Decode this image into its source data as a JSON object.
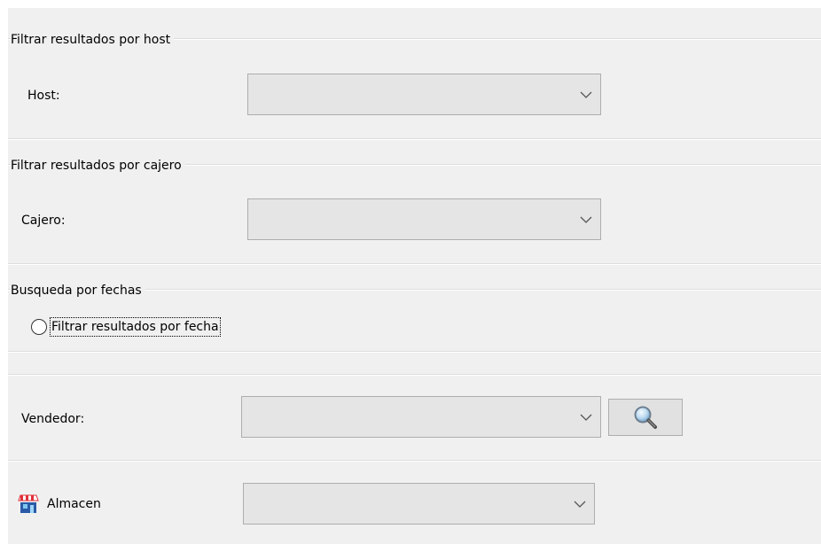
{
  "groups": {
    "host": {
      "title": "Filtrar resultados por host",
      "label": "Host:",
      "value": ""
    },
    "cajero": {
      "title": "Filtrar resultados por cajero",
      "label": "Cajero:",
      "value": ""
    },
    "fechas": {
      "title": "Busqueda por fechas",
      "radio_label": "Filtrar resultados por fecha",
      "radio_checked": false
    }
  },
  "vendedor": {
    "label": "Vendedor:",
    "value": "",
    "search_button_icon": "magnifier-icon"
  },
  "almacen": {
    "icon": "store-icon",
    "label": "Almacen",
    "value": ""
  },
  "colors": {
    "panel_bg": "#f0f0f0",
    "combo_bg": "#e5e5e5",
    "combo_border": "#adadad"
  }
}
